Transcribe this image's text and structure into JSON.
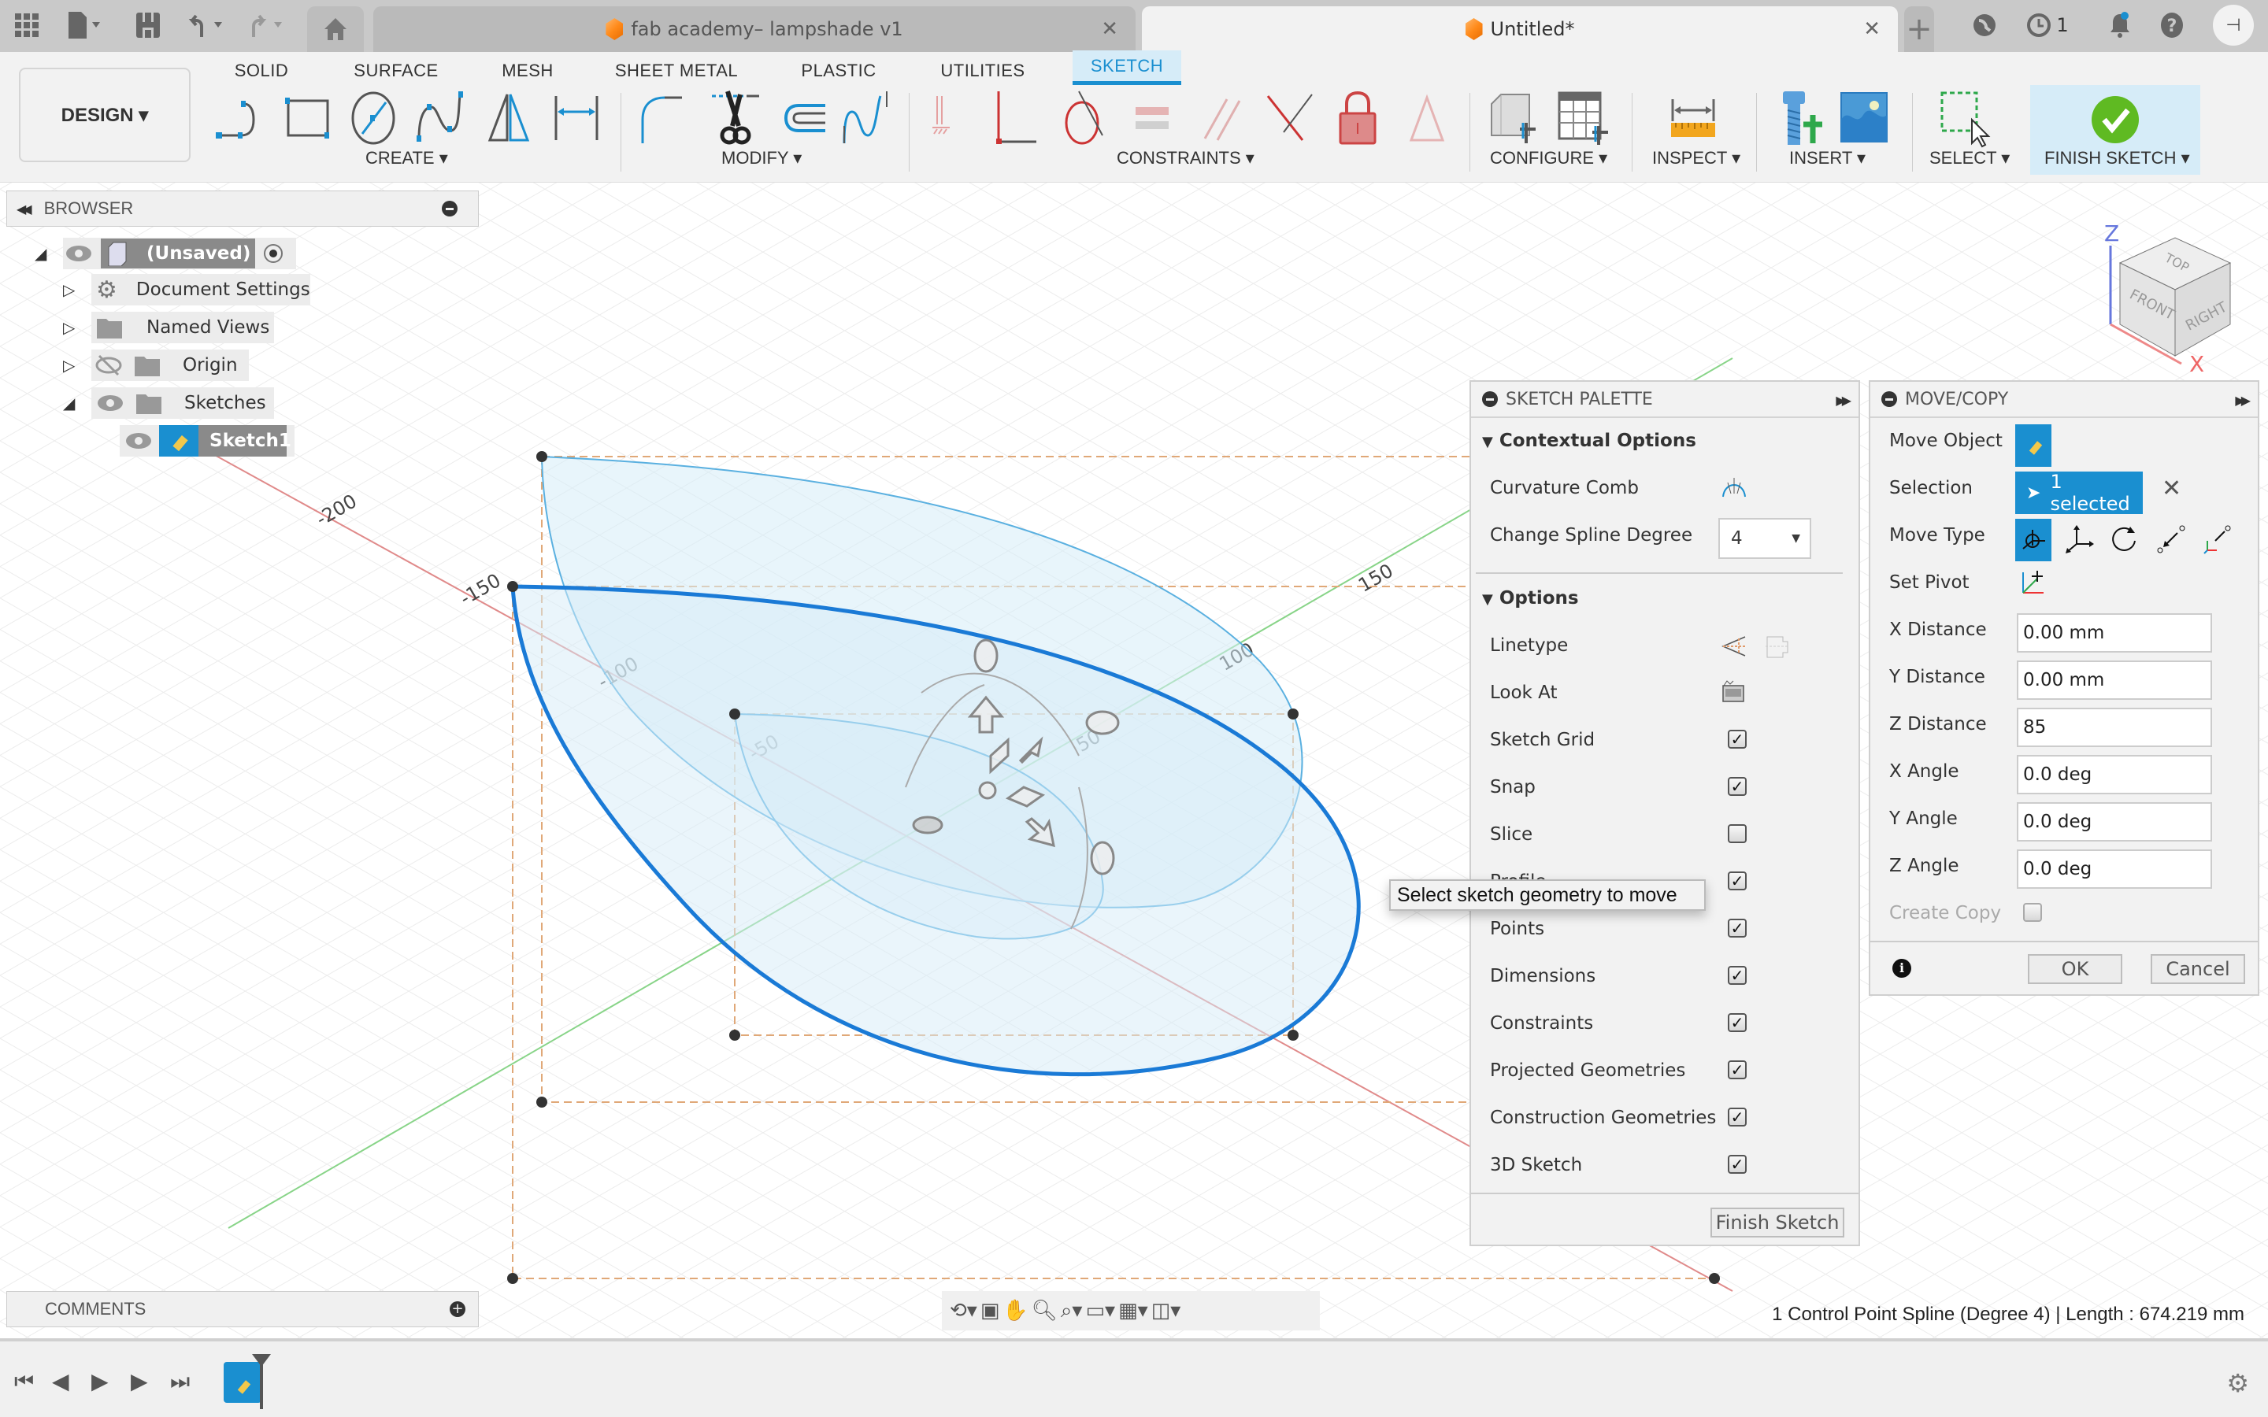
{
  "titlebar": {
    "tabs": [
      {
        "label": "fab academy– lampshade v1",
        "active": false
      },
      {
        "label": "Untitled*",
        "active": true
      }
    ],
    "job_count": "1"
  },
  "ribbon": {
    "workspace": "DESIGN ▾",
    "tabs": [
      "SOLID",
      "SURFACE",
      "MESH",
      "SHEET METAL",
      "PLASTIC",
      "UTILITIES",
      "SKETCH"
    ],
    "active_tab": "SKETCH",
    "groups": [
      "CREATE ▾",
      "MODIFY ▾",
      "CONSTRAINTS ▾",
      "CONFIGURE ▾",
      "INSPECT ▾",
      "INSERT ▾",
      "SELECT ▾",
      "FINISH SKETCH ▾"
    ]
  },
  "browser": {
    "title": "BROWSER",
    "items": [
      {
        "label": "(Unsaved)"
      },
      {
        "label": "Document Settings"
      },
      {
        "label": "Named Views"
      },
      {
        "label": "Origin"
      },
      {
        "label": "Sketches"
      },
      {
        "label": "Sketch1"
      }
    ]
  },
  "viewport": {
    "axis_labels": [
      "-200",
      "-150",
      "-100",
      "-50",
      "50",
      "100",
      "150"
    ],
    "viewcube": {
      "top": "TOP",
      "front": "FRONT",
      "right": "RIGHT",
      "z": "Z",
      "x": "X"
    },
    "tooltip": "Select sketch geometry to move"
  },
  "sketch_palette": {
    "title": "SKETCH PALETTE",
    "contextual_title": "Contextual Options",
    "curvature_comb": "Curvature Comb",
    "spline_degree_label": "Change Spline Degree",
    "spline_degree_value": "4",
    "options_title": "Options",
    "linetype": "Linetype",
    "look_at": "Look At",
    "checkboxes": [
      {
        "label": "Sketch Grid",
        "checked": true
      },
      {
        "label": "Snap",
        "checked": true
      },
      {
        "label": "Slice",
        "checked": false
      },
      {
        "label": "Profile",
        "checked": true
      },
      {
        "label": "Points",
        "checked": true
      },
      {
        "label": "Dimensions",
        "checked": true
      },
      {
        "label": "Constraints",
        "checked": true
      },
      {
        "label": "Projected Geometries",
        "checked": true
      },
      {
        "label": "Construction Geometries",
        "checked": true
      },
      {
        "label": "3D Sketch",
        "checked": true
      }
    ],
    "finish_button": "Finish Sketch"
  },
  "move_copy": {
    "title": "MOVE/COPY",
    "move_object": "Move Object",
    "selection_label": "Selection",
    "selection_value": "1 selected",
    "move_type": "Move Type",
    "set_pivot": "Set Pivot",
    "fields": [
      {
        "label": "X Distance",
        "value": "0.00 mm"
      },
      {
        "label": "Y Distance",
        "value": "0.00 mm"
      },
      {
        "label": "Z Distance",
        "value": "85"
      },
      {
        "label": "X Angle",
        "value": "0.0 deg"
      },
      {
        "label": "Y Angle",
        "value": "0.0 deg"
      },
      {
        "label": "Z Angle",
        "value": "0.0 deg"
      }
    ],
    "create_copy": "Create Copy",
    "create_copy_checked": false,
    "ok": "OK",
    "cancel": "Cancel"
  },
  "comments": {
    "title": "COMMENTS"
  },
  "status": "1 Control Point Spline (Degree 4) | Length : 674.219 mm",
  "colors": {
    "accent": "#0696d7",
    "spline": "#1a7ad6",
    "fill": "#d6ecf8",
    "finish": "#5fba22"
  }
}
